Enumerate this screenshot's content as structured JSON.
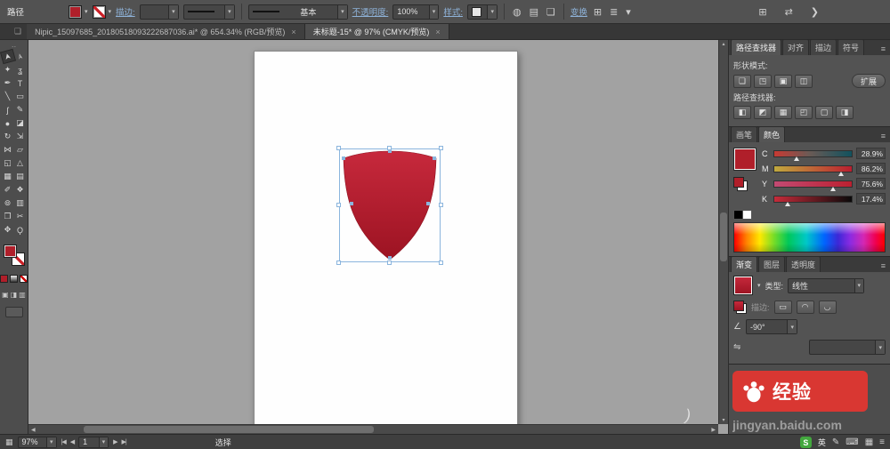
{
  "glyphs": {
    "dropdown": "▾",
    "up": "▴",
    "menu": "≡",
    "grip": "‥",
    "globe": "◍",
    "grid": "▤",
    "doc": "❏",
    "arrange": "⊞",
    "rows": "≣",
    "swap": "⇄",
    "chevron": "❯",
    "left": "◀",
    "right": "▶",
    "bar": "|",
    "angle": "∠",
    "reverse": "⇋",
    "keyboard": "⌨",
    "pen": "✎",
    "grid2": "▦"
  },
  "topbar": {
    "context_label": "路径",
    "stroke_link": "描边:",
    "brush_name": "基本",
    "opacity_link": "不透明度:",
    "opacity_value": "100%",
    "style_link": "样式:",
    "transform_link": "变换"
  },
  "doc_tabs": {
    "tab1": {
      "label": "Nipic_15097685_20180518093222687036.ai* @ 654.34% (RGB/预览)",
      "close": "×"
    },
    "tab2": {
      "label": "未标题-15* @ 97% (CMYK/预览)",
      "close": "×"
    }
  },
  "tools": [
    {
      "name": "selection-tool",
      "glyph": "➤"
    },
    {
      "name": "direct-selection-tool",
      "glyph": "➢"
    },
    {
      "name": "magic-wand-tool",
      "glyph": "✦"
    },
    {
      "name": "lasso-tool",
      "glyph": "ʓ"
    },
    {
      "name": "pen-tool",
      "glyph": "✒"
    },
    {
      "name": "type-tool",
      "glyph": "T"
    },
    {
      "name": "line-tool",
      "glyph": "╲"
    },
    {
      "name": "rectangle-tool",
      "glyph": "▭"
    },
    {
      "name": "paintbrush-tool",
      "glyph": "ʃ"
    },
    {
      "name": "pencil-tool",
      "glyph": "✎"
    },
    {
      "name": "blob-brush-tool",
      "glyph": "●"
    },
    {
      "name": "eraser-tool",
      "glyph": "◪"
    },
    {
      "name": "rotate-tool",
      "glyph": "↻"
    },
    {
      "name": "scale-tool",
      "glyph": "⇲"
    },
    {
      "name": "width-tool",
      "glyph": "⋈"
    },
    {
      "name": "free-transform-tool",
      "glyph": "▱"
    },
    {
      "name": "shape-builder-tool",
      "glyph": "◱"
    },
    {
      "name": "perspective-grid-tool",
      "glyph": "△"
    },
    {
      "name": "mesh-tool",
      "glyph": "▦"
    },
    {
      "name": "gradient-tool",
      "glyph": "▤"
    },
    {
      "name": "eyedropper-tool",
      "glyph": "✐"
    },
    {
      "name": "blend-tool",
      "glyph": "❖"
    },
    {
      "name": "symbol-sprayer-tool",
      "glyph": "⊚"
    },
    {
      "name": "column-graph-tool",
      "glyph": "▥"
    },
    {
      "name": "artboard-tool",
      "glyph": "❐"
    },
    {
      "name": "slice-tool",
      "glyph": "✂"
    },
    {
      "name": "hand-tool",
      "glyph": "✥"
    },
    {
      "name": "zoom-tool",
      "glyph": "Ϙ"
    }
  ],
  "tools_extra": {
    "draw_modes": [
      "▣",
      "◨",
      "▥"
    ]
  },
  "dock": {
    "pathfinder": {
      "tabs": [
        "路径查找器",
        "对齐",
        "描边",
        "符号"
      ],
      "shape_mode_label": "形状模式:",
      "shape_modes": [
        "❏",
        "◳",
        "▣",
        "◫"
      ],
      "expand_button": "扩展",
      "pathfinder_label": "路径查找器:",
      "pathfinder_btns": [
        "◧",
        "◩",
        "▦",
        "◰",
        "▢",
        "◨"
      ]
    },
    "color": {
      "tabs": [
        "画笔",
        "颜色"
      ],
      "sliders": [
        {
          "channel": "C",
          "value": "28.9%",
          "thumb_left": "28.9%"
        },
        {
          "channel": "M",
          "value": "86.2%",
          "thumb_left": "86.2%"
        },
        {
          "channel": "Y",
          "value": "75.6%",
          "thumb_left": "75.6%"
        },
        {
          "channel": "K",
          "value": "17.4%",
          "thumb_left": "17.4%"
        }
      ]
    },
    "gradient": {
      "tabs": [
        "渐变",
        "图层",
        "透明度"
      ],
      "type_label": "类型:",
      "type_value": "线性",
      "stroke_label": "描边:",
      "gstroke_btns": [
        "▭",
        "◠",
        "◡"
      ],
      "angle_value": "-90°"
    },
    "watermark": {
      "brand": "经验",
      "url": "jingyan.baidu.com"
    }
  },
  "statusbar": {
    "zoom": "97%",
    "page": "1",
    "tool_label": "选择"
  },
  "ime": {
    "sogou": "S",
    "lang": "英"
  },
  "colors": {
    "accent_red": "#b01f2a",
    "shield_top": "#c7293c",
    "shield_bottom": "#9c1322",
    "selection": "#8bb5dd",
    "canvas_bg": "#a2a2a2",
    "baidu_red": "#d93732"
  }
}
